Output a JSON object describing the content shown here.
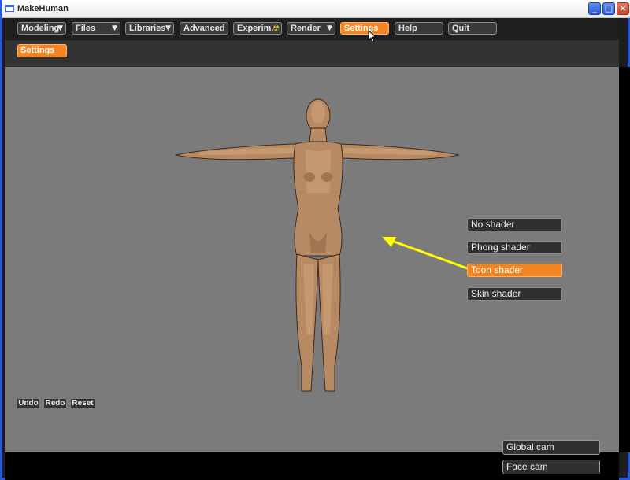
{
  "window": {
    "title": "MakeHuman"
  },
  "toolbar": {
    "items": [
      {
        "label": "Modeling",
        "dropdown": true,
        "active": false
      },
      {
        "label": "Files",
        "dropdown": true,
        "active": false
      },
      {
        "label": "Libraries",
        "dropdown": true,
        "active": false
      },
      {
        "label": "Advanced",
        "dropdown": false,
        "active": false
      },
      {
        "label": "Experim.",
        "dropdown": false,
        "active": false,
        "icon": "radiation-icon"
      },
      {
        "label": "Render",
        "dropdown": true,
        "active": false
      },
      {
        "label": "Settings",
        "dropdown": false,
        "active": true
      },
      {
        "label": "Help",
        "dropdown": false,
        "active": false
      },
      {
        "label": "Quit",
        "dropdown": false,
        "active": false
      }
    ]
  },
  "subtabs": {
    "settings_label": "Settings"
  },
  "shaders": {
    "items": [
      {
        "label": "No shader",
        "active": false
      },
      {
        "label": "Phong shader",
        "active": false
      },
      {
        "label": "Toon shader",
        "active": true
      },
      {
        "label": "Skin shader",
        "active": false
      }
    ]
  },
  "history": {
    "undo": "Undo",
    "redo": "Redo",
    "reset": "Reset"
  },
  "camera": {
    "global": "Global cam",
    "face": "Face cam"
  },
  "colors": {
    "accent": "#f28522",
    "viewport": "#7b7b7b",
    "annotation_arrow": "#ffff00"
  }
}
